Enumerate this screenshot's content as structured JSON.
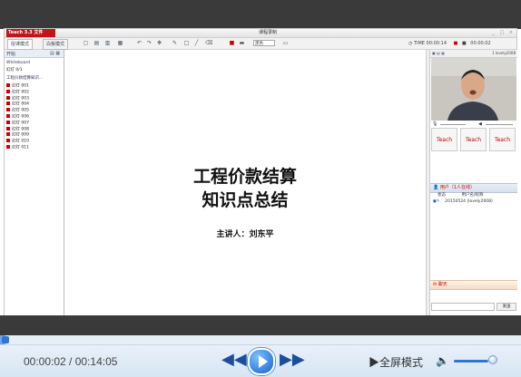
{
  "app": {
    "logo_text": "Teach 3.3 文件",
    "window_title": "课程录制",
    "window_controls": "_ □ ×"
  },
  "toolbar": {
    "tab_lecture": "授课模式",
    "tab_desktop": "白板模式",
    "color_select": "黑色",
    "time_label": "TIME 00:00:14",
    "time_total": "00:00:02"
  },
  "left_panel": {
    "header": "开始",
    "whiteboard": "Whiteboard",
    "doc_root": "工程价款结算知识...",
    "pages": [
      "幻灯 001",
      "幻灯 002",
      "幻灯 003",
      "幻灯 004",
      "幻灯 005",
      "幻灯 006",
      "幻灯 007",
      "幻灯 008",
      "幻灯 009",
      "幻灯 010",
      "幻灯 011"
    ],
    "page_top": "幻灯 0/1"
  },
  "slide": {
    "title_line1": "工程价款结算",
    "title_line2": "知识点总结",
    "speaker": "主讲人：刘东平"
  },
  "right_panel": {
    "cam_label": "1 lovely2008",
    "thumb_labels": [
      "Teach",
      "Teach",
      "Teach"
    ],
    "users_header": "用户（1人在线）",
    "user_cols": [
      "状态",
      "用户名/昵称"
    ],
    "user_row": "20150524 (lovely2008)",
    "chat_header": "聊天",
    "send_label": "发送"
  },
  "player": {
    "current_time": "00:00:02",
    "total_time": "00:14:05",
    "time_display": "00:00:02  / 00:14:05",
    "progress_fraction": 0.0024,
    "fullscreen_label": "▶全屏模式",
    "volume_level": 0.82,
    "accent_color": "#1464d0"
  }
}
